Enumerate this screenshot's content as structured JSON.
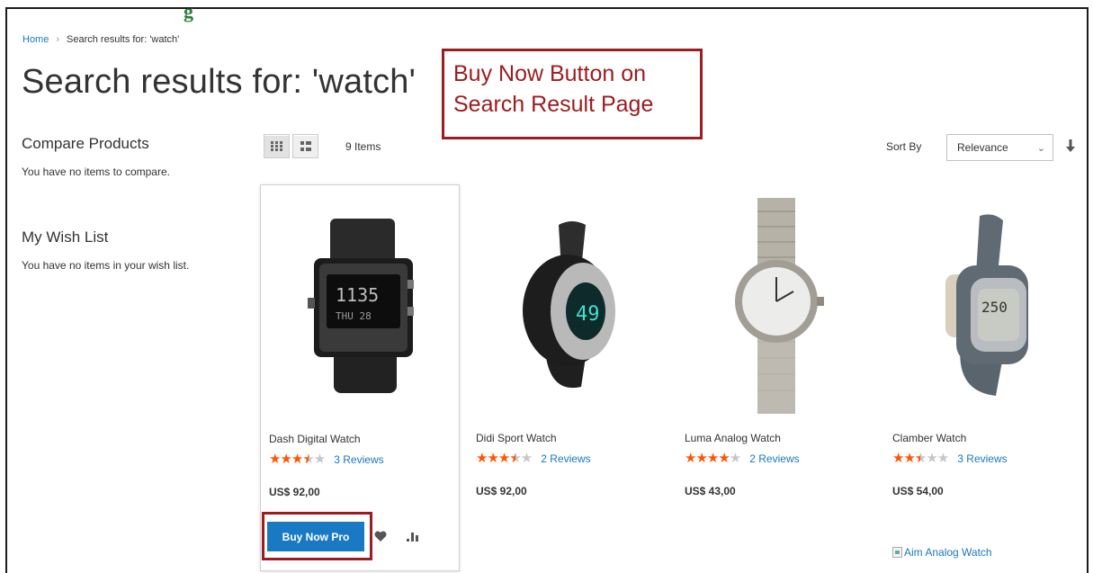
{
  "header_fragment": "g",
  "breadcrumb": {
    "home": "Home",
    "separator": "›",
    "current": "Search results for: 'watch'"
  },
  "page_title": "Search results for: 'watch'",
  "annotation": {
    "line1": "Buy Now Button on",
    "line2": "Search Result Page",
    "color": "#9c1c1f"
  },
  "sidebar": {
    "compare_title": "Compare Products",
    "compare_text": "You have no items to compare.",
    "wishlist_title": "My Wish List",
    "wishlist_text": "You have no items in your wish list."
  },
  "toolbar": {
    "grid_icon": "grid-view-icon",
    "list_icon": "list-view-icon",
    "items_count": "9 Items",
    "sort_label": "Sort By",
    "sort_value": "Relevance",
    "sort_dir_icon": "arrow-down-icon"
  },
  "products": [
    {
      "name": "Dash Digital Watch",
      "rating": 3.5,
      "reviews": "3 Reviews",
      "price": "US$ 92,00",
      "buy_label": "Buy Now Pro"
    },
    {
      "name": "Didi Sport Watch",
      "rating": 3.5,
      "reviews": "2 Reviews",
      "price": "US$ 92,00"
    },
    {
      "name": "Luma Analog Watch",
      "rating": 4.0,
      "reviews": "2 Reviews",
      "price": "US$ 43,00"
    },
    {
      "name": "Clamber Watch",
      "rating": 2.5,
      "reviews": "3 Reviews",
      "price": "US$ 54,00"
    }
  ],
  "broken_image_alt": "Aim Analog Watch",
  "colors": {
    "accent": "#1979c3",
    "stars": "#ff5501",
    "annotation": "#9c1c1f"
  }
}
